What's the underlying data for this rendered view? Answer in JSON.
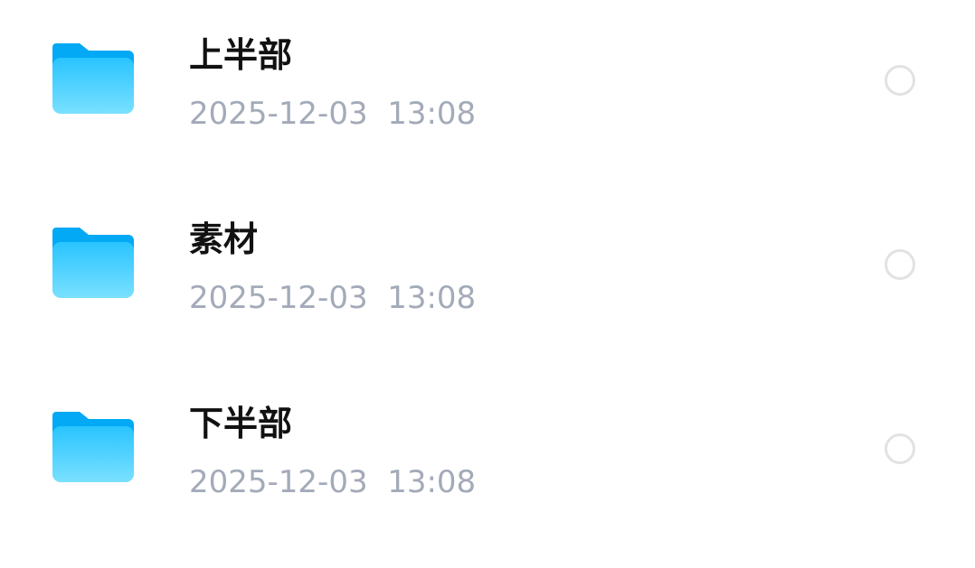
{
  "files": [
    {
      "name": "上半部",
      "date": "2025-12-03  13:08",
      "icon": "folder-icon"
    },
    {
      "name": "素材",
      "date": "2025-12-03  13:08",
      "icon": "folder-icon"
    },
    {
      "name": "下半部",
      "date": "2025-12-03  13:08",
      "icon": "folder-icon"
    }
  ],
  "colors": {
    "folder_tab": "#03A9F4",
    "folder_body_top": "#29C4FF",
    "folder_body_bottom": "#7AE0FF",
    "name_text": "#111111",
    "date_text": "#A3AAB9",
    "radio_border": "#E2E2E2"
  }
}
